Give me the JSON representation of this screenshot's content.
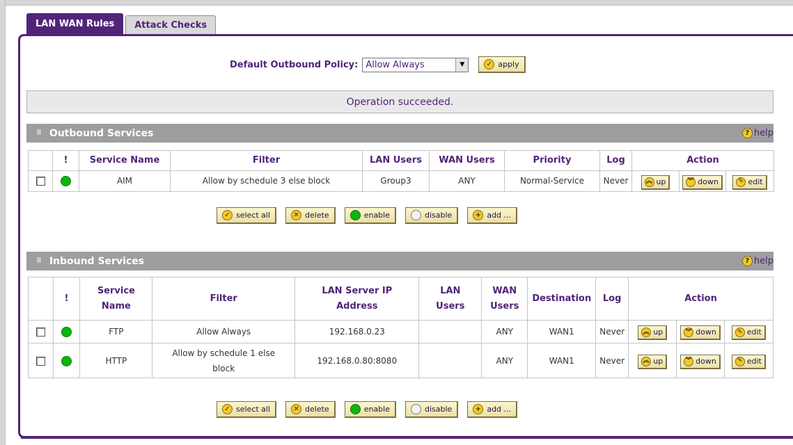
{
  "tabs": [
    {
      "label": "LAN WAN Rules",
      "active": true
    },
    {
      "label": "Attack Checks",
      "active": false
    }
  ],
  "policy": {
    "label": "Default Outbound Policy:",
    "value": "Allow Always",
    "apply_label": "apply"
  },
  "status_message": "Operation succeeded.",
  "outbound": {
    "title": "Outbound Services",
    "help_label": "help",
    "headers": [
      "!",
      "Service Name",
      "Filter",
      "LAN Users",
      "WAN Users",
      "Priority",
      "Log",
      "Action"
    ],
    "rows": [
      {
        "service": "AIM",
        "filter": "Allow by schedule 3 else block",
        "lan_users": "Group3",
        "wan_users": "ANY",
        "priority": "Normal-Service",
        "log": "Never",
        "enabled": true
      }
    ]
  },
  "inbound": {
    "title": "Inbound Services",
    "help_label": "help",
    "headers": {
      "bang": "!",
      "service_l1": "Service",
      "service_l2": "Name",
      "filter": "Filter",
      "ip_l1": "LAN Server IP",
      "ip_l2": "Address",
      "lan_l1": "LAN",
      "lan_l2": "Users",
      "wan_l1": "WAN",
      "wan_l2": "Users",
      "destination": "Destination",
      "log": "Log",
      "action": "Action"
    },
    "rows": [
      {
        "service": "FTP",
        "filter": "Allow Always",
        "filter_l2": "",
        "ip": "192.168.0.23",
        "lan_users": "",
        "wan_users": "ANY",
        "destination": "WAN1",
        "log": "Never",
        "enabled": true
      },
      {
        "service": "HTTP",
        "filter": "Allow by schedule 1 else",
        "filter_l2": "block",
        "ip": "192.168.0.80:8080",
        "lan_users": "",
        "wan_users": "ANY",
        "destination": "WAN1",
        "log": "Never",
        "enabled": true
      }
    ]
  },
  "actions": {
    "up": "up",
    "down": "down",
    "edit": "edit"
  },
  "bulk_buttons": {
    "select_all": "select all",
    "delete": "delete",
    "enable": "enable",
    "disable": "disable",
    "add": "add ..."
  },
  "colors": {
    "accent": "#51247a",
    "section_header": "#9e9e9e",
    "button_face": "#f4edbf",
    "status_green": "#11b511"
  }
}
